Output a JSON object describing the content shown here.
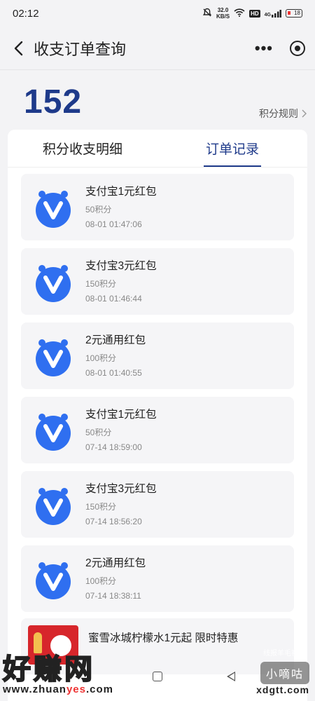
{
  "status_bar": {
    "time": "02:12",
    "speed_value": "32.0",
    "speed_unit": "KB/S",
    "hd": "HD",
    "signal": "4G",
    "battery": "18"
  },
  "navbar": {
    "title": "收支订单查询"
  },
  "points": {
    "value": "152",
    "rules_label": "积分规则"
  },
  "tabs": [
    {
      "label": "积分收支明细",
      "active": false
    },
    {
      "label": "订单记录",
      "active": true
    }
  ],
  "orders": [
    {
      "title": "支付宝1元红包",
      "points": "50积分",
      "time": "08-01 01:47:06"
    },
    {
      "title": "支付宝3元红包",
      "points": "150积分",
      "time": "08-01 01:46:44"
    },
    {
      "title": "2元通用红包",
      "points": "100积分",
      "time": "08-01 01:40:55"
    },
    {
      "title": "支付宝1元红包",
      "points": "50积分",
      "time": "07-14 18:59:00"
    },
    {
      "title": "支付宝3元红包",
      "points": "150积分",
      "time": "07-14 18:56:20"
    },
    {
      "title": "2元通用红包",
      "points": "100积分",
      "time": "07-14 18:38:11"
    }
  ],
  "promo": {
    "title": "蜜雪冰城柠檬水1元起 限时特惠"
  },
  "watermark": {
    "left_big": "好赚网",
    "left_url_a": "www.zhuan",
    "left_url_b": "yes",
    "left_url_c": ".com",
    "right_badge": "小嘀咕",
    "right_url": "xdgtt.com",
    "tiny": "线报羊毛社区"
  },
  "colors": {
    "accent": "#1e3a8a",
    "logo_blue": "#2f6ff0"
  }
}
